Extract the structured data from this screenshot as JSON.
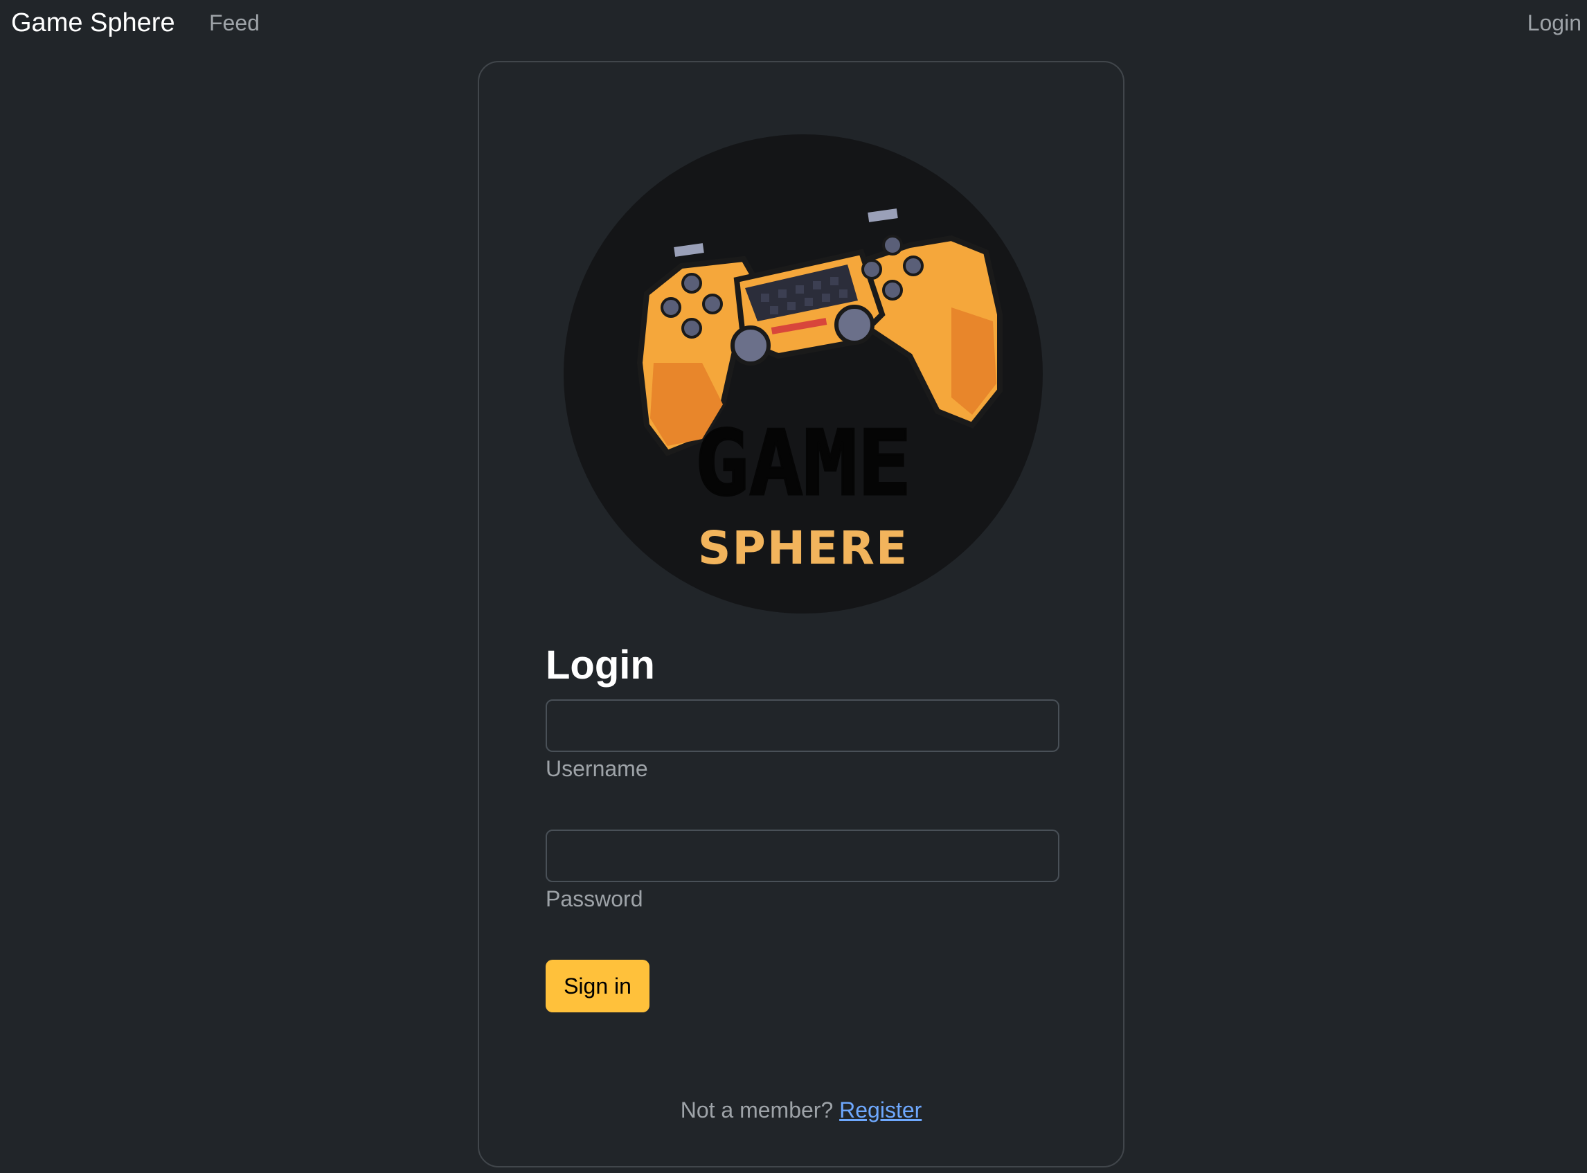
{
  "navbar": {
    "brand": "Game Sphere",
    "feed_label": "Feed",
    "login_label": "Login"
  },
  "logo": {
    "icon": "gamepad-icon",
    "text_top": "GAME",
    "text_bottom": "SPHERE"
  },
  "form": {
    "heading": "Login",
    "username_label": "Username",
    "username_value": "",
    "password_label": "Password",
    "password_value": "",
    "submit_label": "Sign in",
    "register_prompt": "Not a member?",
    "register_link": "Register"
  },
  "colors": {
    "background": "#212529",
    "accent": "#ffc13b",
    "link": "#6ea8fe",
    "logo_orange": "#f5a73b"
  }
}
